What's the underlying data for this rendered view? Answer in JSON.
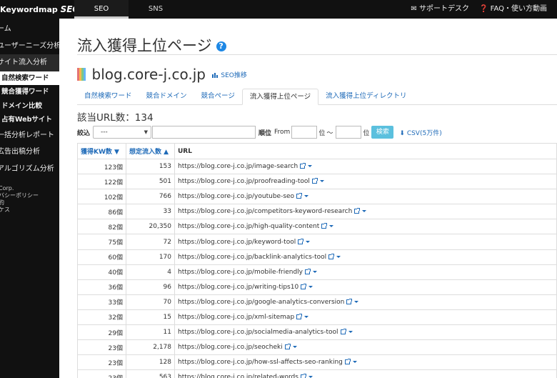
{
  "header": {
    "logo_prefix": "Keywordmap",
    "logo_suffix": "SEO",
    "tabs": [
      "SEO",
      "SNS"
    ],
    "support_label": "サポートデスク",
    "faq_label": "FAQ・使い方動画"
  },
  "sidebar": {
    "items": [
      {
        "label": "ーム",
        "type": "lvl1"
      },
      {
        "label": "ユーザーニーズ分析",
        "type": "lvl1"
      },
      {
        "label": "サイト流入分析",
        "type": "lvl1"
      },
      {
        "label": "自然検索ワード",
        "type": "sub"
      },
      {
        "label": "競合獲得ワード",
        "type": "sub"
      },
      {
        "label": "ドメイン比較",
        "type": "sub"
      },
      {
        "label": "占有Webサイト",
        "type": "sub"
      },
      {
        "label": "一括分析レポート",
        "type": "lvl1"
      },
      {
        "label": "広告出稿分析",
        "type": "lvl1"
      },
      {
        "label": "アルゴリズム分析",
        "type": "lvl1"
      }
    ],
    "footer": [
      "Corp.",
      "バシーポリシー",
      "約",
      "",
      "ケス"
    ]
  },
  "page": {
    "title": "流入獲得上位ページ",
    "domain": "blog.core-j.co.jp",
    "seo_link": "SEO推移",
    "tabs": [
      "自然検索ワード",
      "競合ドメイン",
      "競合ページ",
      "流入獲得上位ページ",
      "流入獲得上位ディレクトリ"
    ],
    "active_tab_index": 3,
    "count_label": "該当URL数：134"
  },
  "filter": {
    "label": "絞込",
    "select_value": "---",
    "rank_label": "順位",
    "from_label": "From",
    "unit": "位",
    "tilde": "〜",
    "search_button": "検索",
    "csv_label": "CSV(5万件)"
  },
  "table": {
    "headers": [
      "獲得KW数 ▼",
      "想定流入数 ▲",
      "URL"
    ],
    "rows": [
      {
        "kw": "123個",
        "flow": "153",
        "url": "https://blog.core-j.co.jp/image-search"
      },
      {
        "kw": "122個",
        "flow": "501",
        "url": "https://blog.core-j.co.jp/proofreading-tool"
      },
      {
        "kw": "102個",
        "flow": "766",
        "url": "https://blog.core-j.co.jp/youtube-seo"
      },
      {
        "kw": "86個",
        "flow": "33",
        "url": "https://blog.core-j.co.jp/competitors-keyword-research"
      },
      {
        "kw": "82個",
        "flow": "20,350",
        "url": "https://blog.core-j.co.jp/high-quality-content"
      },
      {
        "kw": "75個",
        "flow": "72",
        "url": "https://blog.core-j.co.jp/keyword-tool"
      },
      {
        "kw": "60個",
        "flow": "170",
        "url": "https://blog.core-j.co.jp/backlink-analytics-tool"
      },
      {
        "kw": "40個",
        "flow": "4",
        "url": "https://blog.core-j.co.jp/mobile-friendly"
      },
      {
        "kw": "36個",
        "flow": "96",
        "url": "https://blog.core-j.co.jp/writing-tips10"
      },
      {
        "kw": "33個",
        "flow": "70",
        "url": "https://blog.core-j.co.jp/google-analytics-conversion"
      },
      {
        "kw": "32個",
        "flow": "15",
        "url": "https://blog.core-j.co.jp/xml-sitemap"
      },
      {
        "kw": "29個",
        "flow": "11",
        "url": "https://blog.core-j.co.jp/socialmedia-analytics-tool"
      },
      {
        "kw": "23個",
        "flow": "2,178",
        "url": "https://blog.core-j.co.jp/seocheki"
      },
      {
        "kw": "23個",
        "flow": "128",
        "url": "https://blog.core-j.co.jp/how-ssl-affects-seo-ranking"
      },
      {
        "kw": "23個",
        "flow": "563",
        "url": "https://blog.core-j.co.jp/related-words"
      }
    ]
  },
  "colors": {
    "accent": "#1e6ab8",
    "topbar": "#111111",
    "button": "#5bc0de",
    "domain_bars": [
      "#e57373",
      "#ffb74d",
      "#81c784",
      "#64b5f6",
      "#ba68c8"
    ]
  }
}
